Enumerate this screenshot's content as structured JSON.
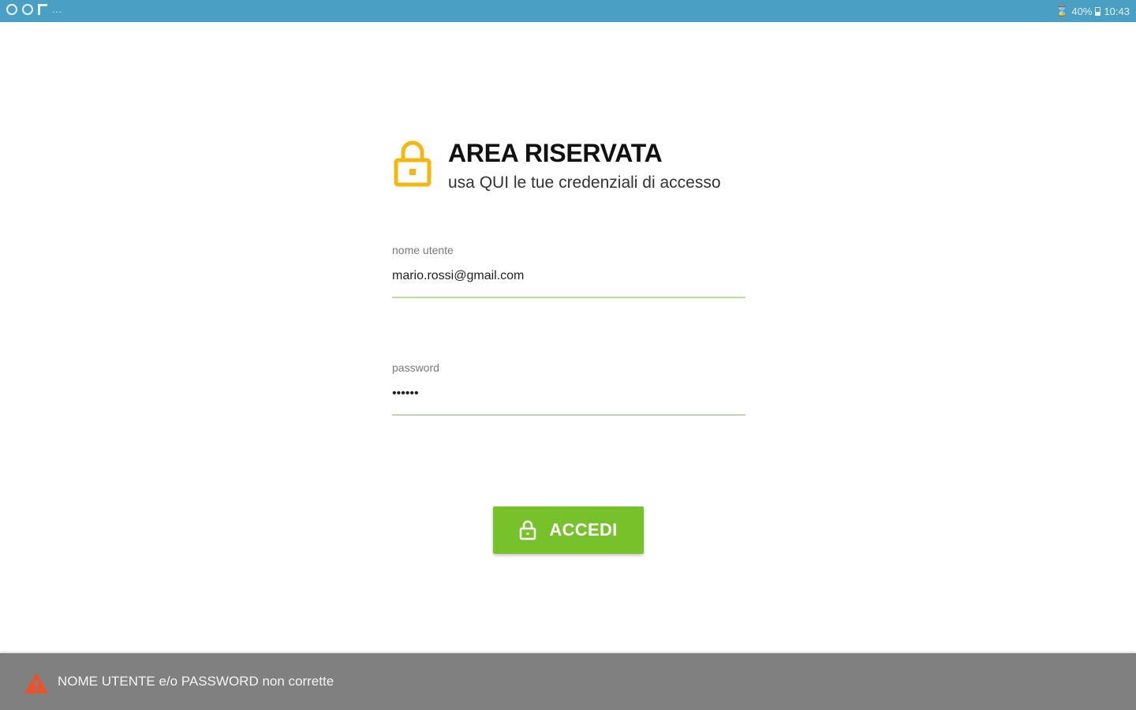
{
  "status_bar": {
    "left_icons": [
      "circle-notification-icon",
      "circle-notification-icon",
      "flag-notification-icon"
    ],
    "overflow": "...",
    "battery_percent": "40%",
    "time": "10:43"
  },
  "header": {
    "icon": "lock-icon",
    "title": "AREA RISERVATA",
    "subtitle": "usa QUI le tue credenziali di accesso"
  },
  "form": {
    "username": {
      "label": "nome utente",
      "value": "mario.rossi@gmail.com"
    },
    "password": {
      "label": "password",
      "value": "••••••"
    },
    "submit": {
      "icon": "lock-icon",
      "label": "ACCEDI"
    }
  },
  "snackbar": {
    "icon": "warning-icon",
    "message": "NOME UTENTE e/o PASSWORD non corrette"
  },
  "colors": {
    "status_bar": "#4a9fc4",
    "accent_lock": "#f5b60d",
    "button": "#77c12b",
    "field_underline": "#b9dcaa",
    "snackbar": "#808080",
    "warning": "#e8532a"
  }
}
